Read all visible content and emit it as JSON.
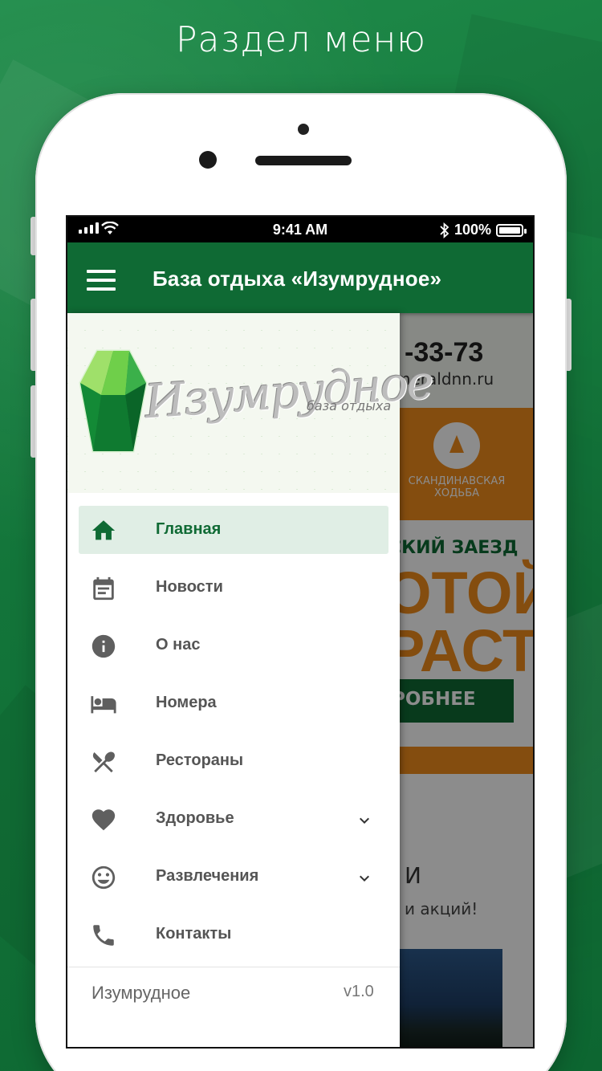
{
  "promo": {
    "title": "Раздел меню"
  },
  "status_bar": {
    "time": "9:41 AM",
    "battery": "100%"
  },
  "app_bar": {
    "title": "База отдыха «Изумрудное»"
  },
  "background_page": {
    "phone_fragment": "-33-73",
    "site_fragment": "meraldnn.ru",
    "activity_label": "СКАНДИНАВСКАЯ ХОДЬБА",
    "promo_line": "СКИЙ ЗАЕЗД",
    "headline_1": "ОТОЙ",
    "headline_2": "РАСТ",
    "more_button": "РОБНЕЕ",
    "news_heading": "И",
    "news_sub": "и акций!"
  },
  "drawer": {
    "logo": {
      "script": "Изумрудное",
      "subtitle": "база отдыха"
    },
    "items": [
      {
        "label": "Главная",
        "icon": "home-icon",
        "active": true,
        "expandable": false
      },
      {
        "label": "Новости",
        "icon": "calendar-icon",
        "active": false,
        "expandable": false
      },
      {
        "label": "О нас",
        "icon": "info-icon",
        "active": false,
        "expandable": false
      },
      {
        "label": "Номера",
        "icon": "bed-icon",
        "active": false,
        "expandable": false
      },
      {
        "label": "Рестораны",
        "icon": "cutlery-icon",
        "active": false,
        "expandable": false
      },
      {
        "label": "Здоровье",
        "icon": "heart-icon",
        "active": false,
        "expandable": true
      },
      {
        "label": "Развлечения",
        "icon": "smiley-icon",
        "active": false,
        "expandable": true
      },
      {
        "label": "Контакты",
        "icon": "phone-icon",
        "active": false,
        "expandable": false
      }
    ],
    "footer": {
      "name": "Изумрудное",
      "version": "v1.0"
    }
  },
  "colors": {
    "primary": "#0f6a34",
    "accent": "#f08c1c",
    "active_bg": "#e0eee5",
    "icon_gray": "#5f5f5f"
  }
}
